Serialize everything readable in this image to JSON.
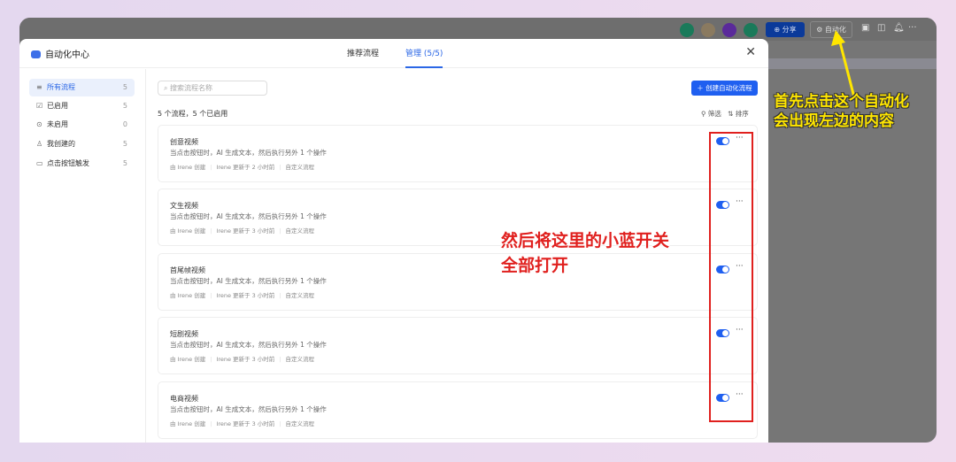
{
  "topbar": {
    "share_label": "分享",
    "automation_label": "自动化",
    "avatar_colors": [
      "#1a7a5a",
      "#8a7a60",
      "#5a2a9a",
      "#1a7a5a"
    ]
  },
  "modal": {
    "title": "自动化中心",
    "tabs": [
      {
        "label": "推荐流程"
      },
      {
        "label": "管理 (5/5)",
        "active": true
      }
    ]
  },
  "sidebar": {
    "items": [
      {
        "label": "所有流程",
        "count": "5",
        "icon": "list-icon"
      },
      {
        "label": "已启用",
        "count": "5",
        "icon": "check-square-icon"
      },
      {
        "label": "未启用",
        "count": "0",
        "icon": "circle-icon"
      },
      {
        "label": "我创建的",
        "count": "5",
        "icon": "user-icon"
      },
      {
        "label": "点击按钮触发",
        "count": "5",
        "icon": "cursor-icon"
      }
    ]
  },
  "main": {
    "search_placeholder": "搜索流程名称",
    "create_label": "创建自动化流程",
    "summary": "5 个流程，5 个已启用",
    "filter_label": "筛选",
    "sort_label": "排序",
    "cards": [
      {
        "title": "创意视频",
        "desc": "当点击按钮时，AI 生成文本，然后执行另外 1 个操作",
        "creator": "由 Irene 创建",
        "updated": "Irene 更新于 2 小时前",
        "type": "自定义流程",
        "enabled": true
      },
      {
        "title": "文生视频",
        "desc": "当点击按钮时，AI 生成文本，然后执行另外 1 个操作",
        "creator": "由 Irene 创建",
        "updated": "Irene 更新于 3 小时前",
        "type": "自定义流程",
        "enabled": true
      },
      {
        "title": "首尾帧视频",
        "desc": "当点击按钮时，AI 生成文本，然后执行另外 1 个操作",
        "creator": "由 Irene 创建",
        "updated": "Irene 更新于 3 小时前",
        "type": "自定义流程",
        "enabled": true
      },
      {
        "title": "短剧视频",
        "desc": "当点击按钮时，AI 生成文本，然后执行另外 1 个操作",
        "creator": "由 Irene 创建",
        "updated": "Irene 更新于 3 小时前",
        "type": "自定义流程",
        "enabled": true
      },
      {
        "title": "电商视频",
        "desc": "当点击按钮时，AI 生成文本，然后执行另外 1 个操作",
        "creator": "由 Irene 创建",
        "updated": "Irene 更新于 3 小时前",
        "type": "自定义流程",
        "enabled": true
      }
    ]
  },
  "annotations": {
    "top_line1": "首先点击这个自动化",
    "top_line2": "会出现左边的内容",
    "mid_line1": "然后将这里的小蓝开关",
    "mid_line2": "全部打开"
  }
}
